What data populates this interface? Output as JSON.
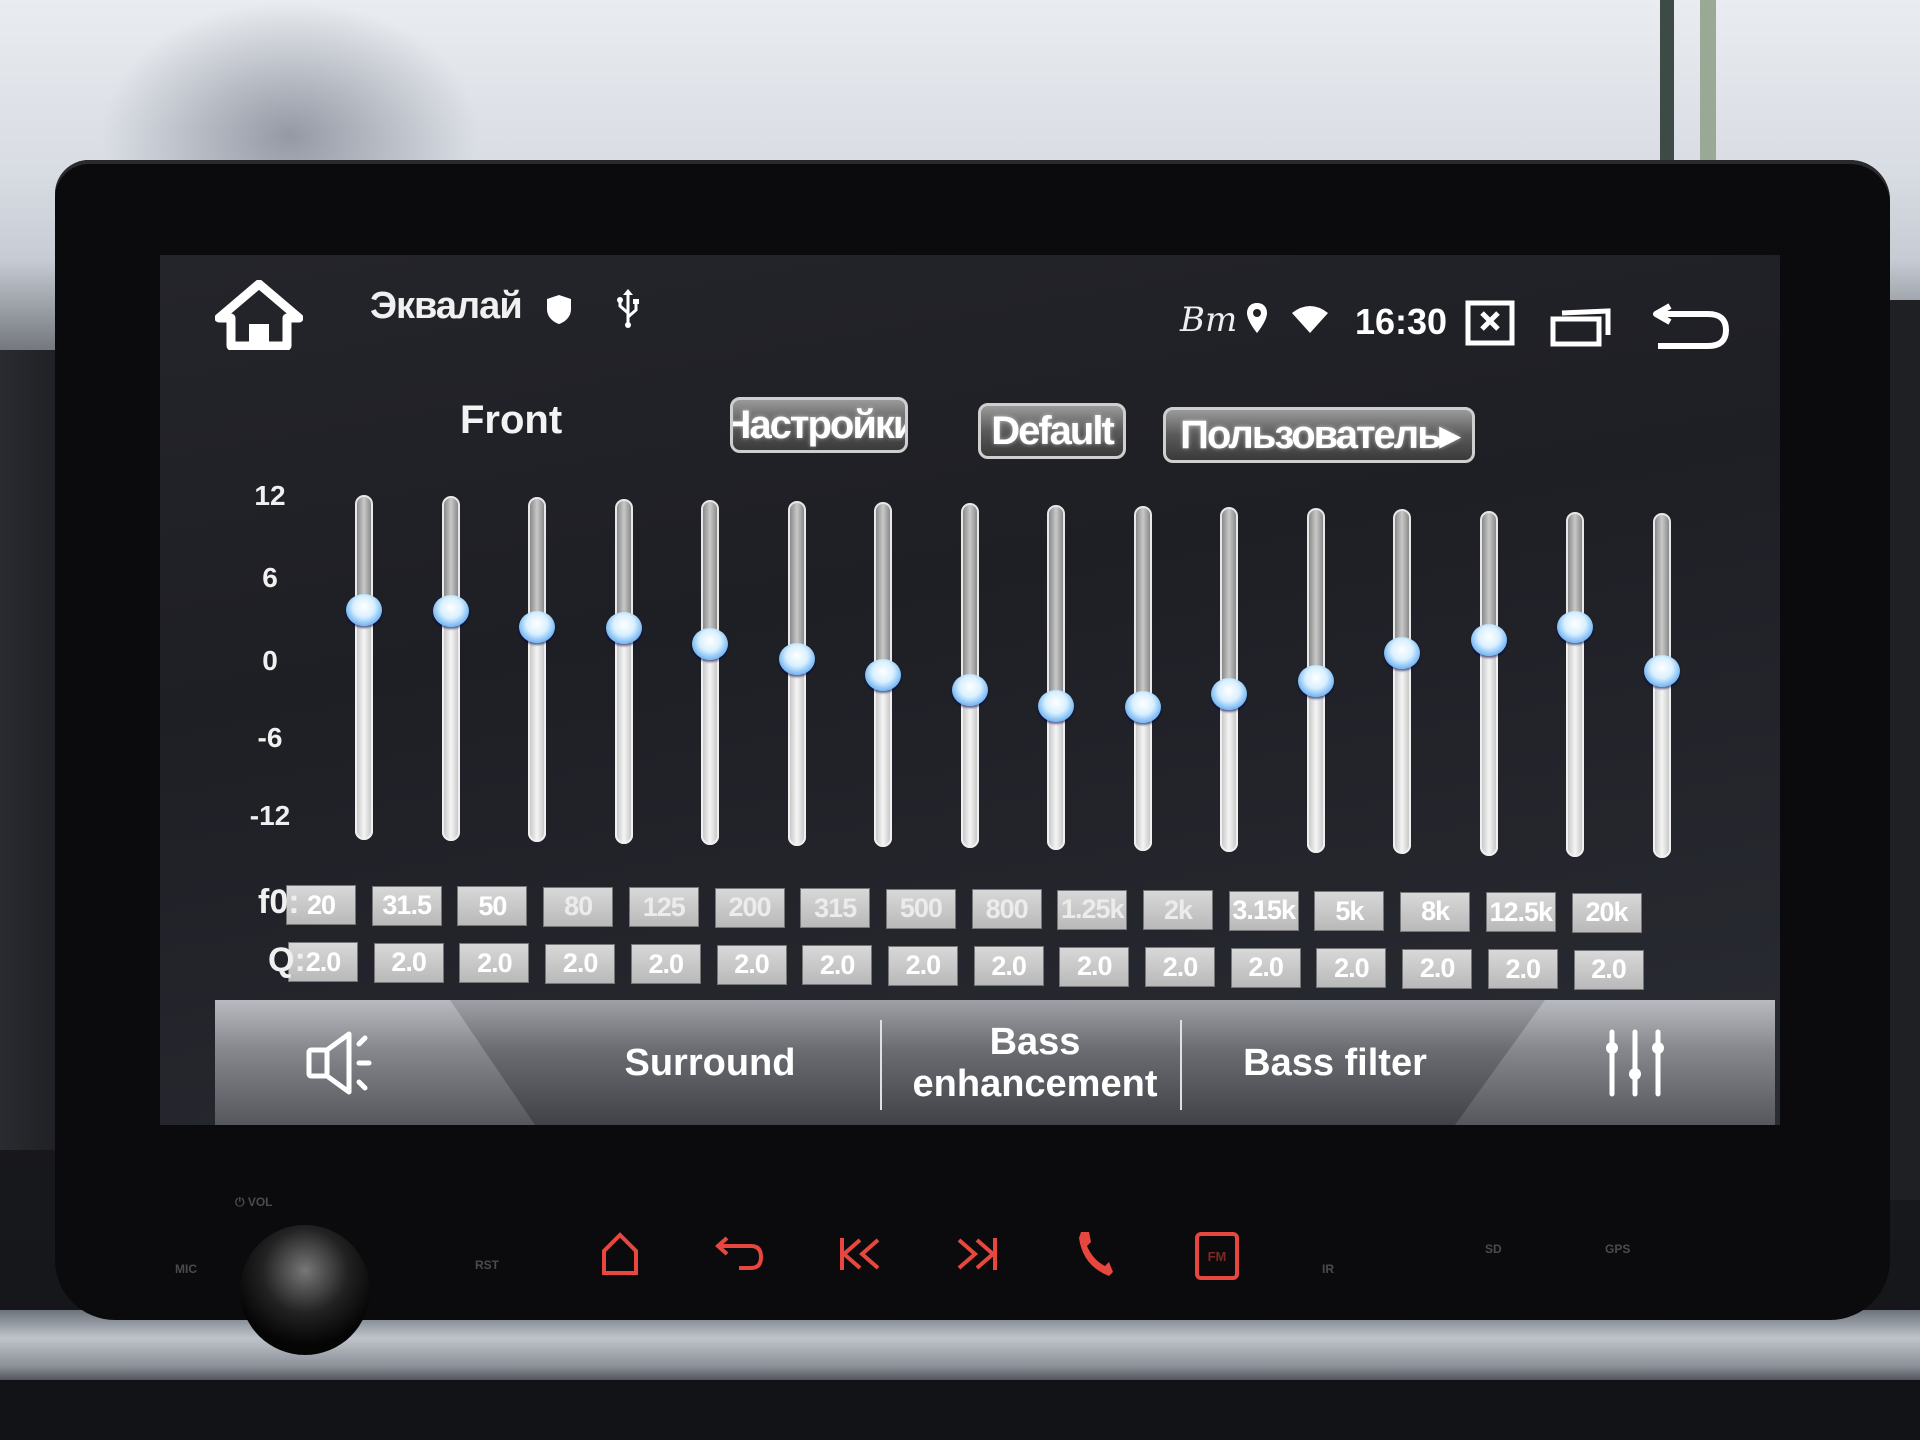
{
  "status_bar": {
    "app_title": "Эквалай",
    "time": "16:30",
    "bt_label": "Bт",
    "icons": [
      "home-icon",
      "shield-icon",
      "usb-icon",
      "bluetooth-icon",
      "location-icon",
      "wifi-icon",
      "close-app-icon",
      "recent-apps-icon",
      "back-icon"
    ]
  },
  "header": {
    "channel": "Front",
    "buttons": {
      "settings": "Настройки",
      "default": "Default",
      "user": "Пользователь▸"
    }
  },
  "eq": {
    "scale_labels": [
      "12",
      "6",
      "0",
      "-6",
      "-12"
    ],
    "range_db": [
      -12,
      12
    ],
    "f0_label": "f0:",
    "q_label": "Q:",
    "bands": [
      {
        "f0": "20",
        "q": "2.0",
        "gain_db": 4
      },
      {
        "f0": "31.5",
        "q": "2.0",
        "gain_db": 4
      },
      {
        "f0": "50",
        "q": "2.0",
        "gain_db": 3
      },
      {
        "f0": "80",
        "q": "2.0",
        "gain_db": 3
      },
      {
        "f0": "125",
        "q": "2.0",
        "gain_db": 2
      },
      {
        "f0": "200",
        "q": "2.0",
        "gain_db": 1
      },
      {
        "f0": "315",
        "q": "2.0",
        "gain_db": 0
      },
      {
        "f0": "500",
        "q": "2.0",
        "gain_db": -1
      },
      {
        "f0": "800",
        "q": "2.0",
        "gain_db": -2
      },
      {
        "f0": "1.25k",
        "q": "2.0",
        "gain_db": -2
      },
      {
        "f0": "2k",
        "q": "2.0",
        "gain_db": -1
      },
      {
        "f0": "3.15k",
        "q": "2.0",
        "gain_db": 0
      },
      {
        "f0": "5k",
        "q": "2.0",
        "gain_db": 2
      },
      {
        "f0": "8k",
        "q": "2.0",
        "gain_db": 3
      },
      {
        "f0": "12.5k",
        "q": "2.0",
        "gain_db": 4
      },
      {
        "f0": "20k",
        "q": "2.0",
        "gain_db": 1
      }
    ]
  },
  "tabs": {
    "sound": "",
    "surround": "Surround",
    "bass_enhancement": "Bass enhancement",
    "bass_filter": "Bass filter",
    "equalizer": ""
  },
  "hardware": {
    "vol_label": "⏻ VOL",
    "mic_label": "MIC",
    "rst_label": "RST",
    "ir_label": "IR",
    "sd_label": "SD",
    "gps_label": "GPS",
    "fm_label": "FM",
    "accent_color": "#e8473f"
  }
}
